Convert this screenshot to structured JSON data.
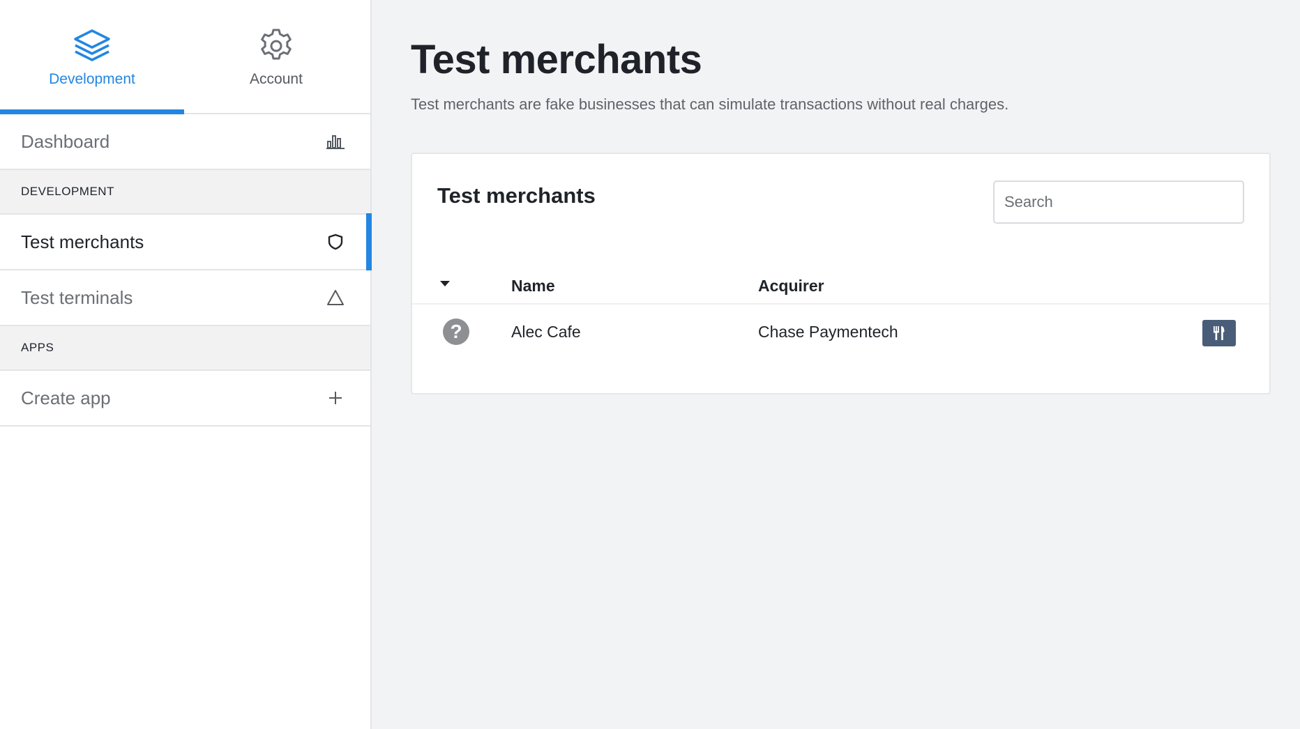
{
  "sidebar": {
    "tabs": [
      {
        "label": "Development",
        "icon": "layers-icon",
        "active": true
      },
      {
        "label": "Account",
        "icon": "gear-icon",
        "active": false
      }
    ],
    "dashboard": {
      "label": "Dashboard",
      "icon": "bar-chart-icon"
    },
    "sections": [
      {
        "header": "DEVELOPMENT",
        "items": [
          {
            "label": "Test merchants",
            "icon": "shield-icon",
            "selected": true
          },
          {
            "label": "Test terminals",
            "icon": "triangle-icon",
            "selected": false
          }
        ]
      },
      {
        "header": "APPS",
        "items": [
          {
            "label": "Create app",
            "icon": "plus-icon",
            "selected": false
          }
        ]
      }
    ]
  },
  "main": {
    "title": "Test merchants",
    "subtitle": "Test merchants are fake businesses that can simulate transactions without real charges.",
    "card": {
      "title": "Test merchants",
      "search_placeholder": "Search",
      "columns": {
        "name": "Name",
        "acquirer": "Acquirer"
      },
      "rows": [
        {
          "status_icon": "question-circle-icon",
          "name": "Alec Cafe",
          "acquirer": "Chase Paymentech",
          "category_icon": "fork-knife-icon"
        }
      ]
    }
  },
  "colors": {
    "accent": "#2386e2",
    "badge": "#4a5d78"
  }
}
